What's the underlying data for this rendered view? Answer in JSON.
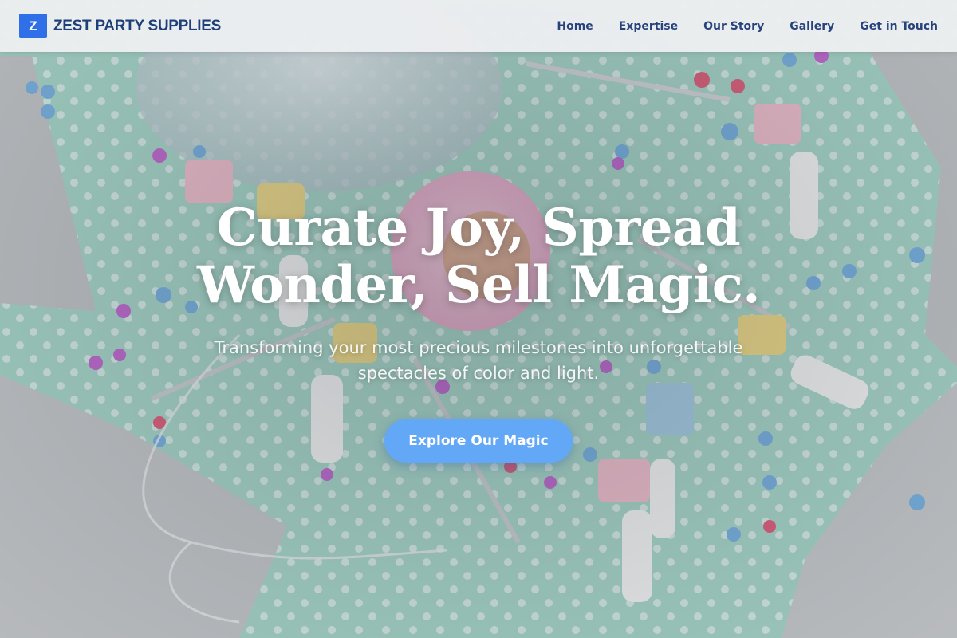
{
  "header": {
    "logo_letter": "Z",
    "brand_name": "ZEST PARTY SUPPLIES",
    "nav": [
      {
        "label": "Home"
      },
      {
        "label": "Expertise"
      },
      {
        "label": "Our Story"
      },
      {
        "label": "Gallery"
      },
      {
        "label": "Get in Touch"
      }
    ]
  },
  "hero": {
    "title": "Curate Joy, Spread Wonder, Sell Magic.",
    "subtitle": "Transforming your most precious milestones into unforgettable spectacles of color and light.",
    "cta_label": "Explore Our Magic",
    "background_image": "party-table-confetti-noisemakers"
  },
  "colors": {
    "brand_blue": "#2f6fe8",
    "nav_text": "#27427c",
    "cta": "#63a8f7",
    "header_bg": "#eceef0"
  }
}
